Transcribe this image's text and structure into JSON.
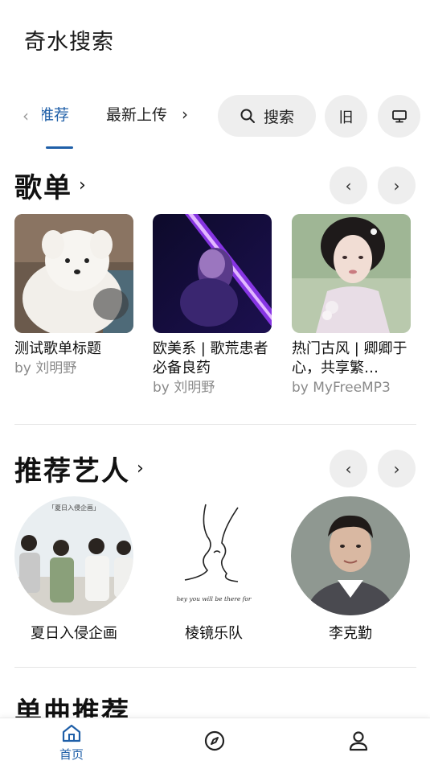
{
  "app": {
    "title": "奇水搜索"
  },
  "tabs": {
    "prev_icon": "chevron-left-icon",
    "items": [
      {
        "label": "推荐",
        "active": true
      },
      {
        "label": "最新上传",
        "active": false
      }
    ],
    "next_icon": "chevron-right-icon",
    "search_label": "搜索",
    "old_label": "旧",
    "display_icon": "monitor-icon"
  },
  "playlists": {
    "title": "歌单",
    "items": [
      {
        "title": "测试歌单标题",
        "author": "by 刘明野"
      },
      {
        "title": "欧美系 | 歌荒患者必备良药",
        "author": "by 刘明野"
      },
      {
        "title": "热门古风 | 卿卿于心，共享繁…",
        "author": "by MyFreeMP3"
      }
    ]
  },
  "artists": {
    "title": "推荐艺人",
    "cover_banner": "「夏日入侵企画」",
    "sketch_caption": "hey you will be there for",
    "items": [
      {
        "name": "夏日入侵企画"
      },
      {
        "name": "棱镜乐队"
      },
      {
        "name": "李克勤"
      }
    ]
  },
  "singles": {
    "title": "单曲推荐"
  },
  "bottom_nav": {
    "items": [
      {
        "label": "首页",
        "icon": "home-icon",
        "active": true
      },
      {
        "label": "",
        "icon": "compass-icon",
        "active": false
      },
      {
        "label": "",
        "icon": "user-icon",
        "active": false
      }
    ]
  },
  "colors": {
    "accent": "#1f5fa8",
    "pill_bg": "#eeeeee",
    "muted_text": "#8a8a8a"
  }
}
